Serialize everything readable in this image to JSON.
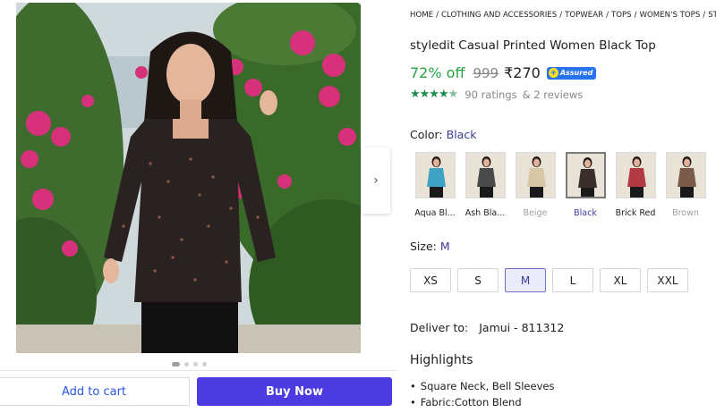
{
  "breadcrumb": [
    "HOME",
    "CLOTHING AND ACCESSORIES",
    "TOPWEAR",
    "TOPS",
    "WOMEN'S TOPS",
    "STYLEDIT"
  ],
  "product": {
    "title": "styledit Casual Printed Women Black Top",
    "discount": "72% off",
    "mrp": "999",
    "price": "₹270",
    "assured_label": "Assured",
    "ratings": "90 ratings",
    "reviews": "& 2 reviews"
  },
  "color": {
    "label": "Color:",
    "selected": "Black",
    "options": [
      {
        "label": "Aqua Bl...",
        "state": "available",
        "top": "#3ea2c4"
      },
      {
        "label": "Ash Bla...",
        "state": "available",
        "top": "#4a4a4a"
      },
      {
        "label": "Beige",
        "state": "disabled",
        "top": "#d8c7a4"
      },
      {
        "label": "Black",
        "state": "selected",
        "top": "#3a2f2c"
      },
      {
        "label": "Brick Red",
        "state": "available",
        "top": "#b23a44"
      },
      {
        "label": "Brown",
        "state": "disabled",
        "top": "#7a5a4a"
      }
    ]
  },
  "size": {
    "label": "Size:",
    "selected": "M",
    "options": [
      "XS",
      "S",
      "M",
      "L",
      "XL",
      "XXL"
    ]
  },
  "delivery": {
    "label": "Deliver to:",
    "location": "Jamui - 811312"
  },
  "highlights": {
    "title": "Highlights",
    "items": [
      "Square Neck, Bell Sleeves",
      "Fabric:Cotton Blend"
    ]
  },
  "actions": {
    "add_to_cart": "Add to cart",
    "buy_now": "Buy Now"
  },
  "colors": {
    "discount_green": "#26a541",
    "buy_button": "#4b3be0",
    "cart_text": "#2a55e5",
    "rating_green": "#1c8e4c"
  },
  "rating_value": 4.5
}
